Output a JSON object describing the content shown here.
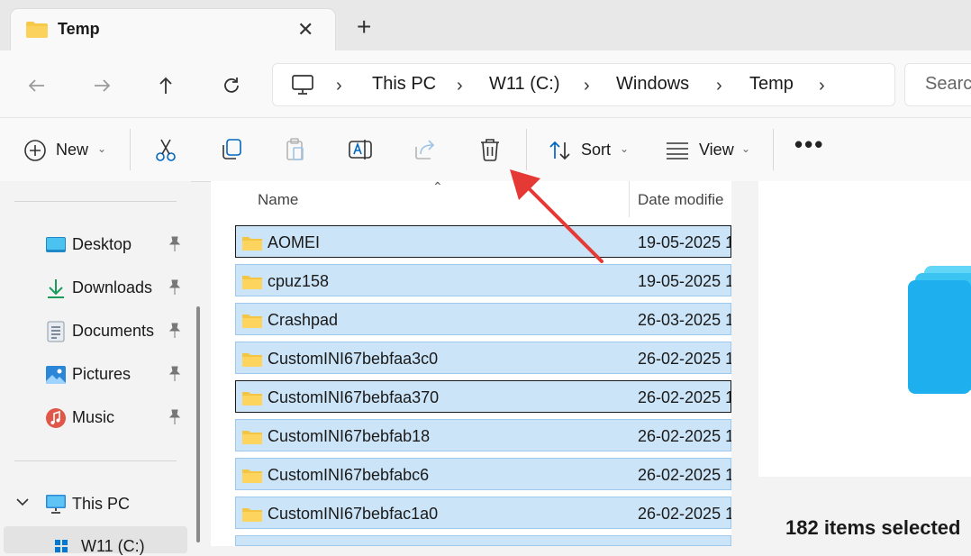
{
  "tab": {
    "title": "Temp",
    "icon": "folder-icon"
  },
  "breadcrumb": [
    "This PC",
    "W11 (C:)",
    "Windows",
    "Temp"
  ],
  "search": {
    "placeholder": "Search"
  },
  "toolbar": {
    "new_label": "New",
    "sort_label": "Sort",
    "view_label": "View"
  },
  "sidebar": {
    "quick_access": [
      {
        "label": "Desktop",
        "icon": "desktop-icon"
      },
      {
        "label": "Downloads",
        "icon": "downloads-icon"
      },
      {
        "label": "Documents",
        "icon": "documents-icon"
      },
      {
        "label": "Pictures",
        "icon": "pictures-icon"
      },
      {
        "label": "Music",
        "icon": "music-icon"
      }
    ],
    "this_pc": "This PC",
    "drive": "W11 (C:)"
  },
  "columns": {
    "name": "Name",
    "date": "Date modifie"
  },
  "files": [
    {
      "name": "AOMEI",
      "date": "19-05-2025 1"
    },
    {
      "name": "cpuz158",
      "date": "19-05-2025 1"
    },
    {
      "name": "Crashpad",
      "date": "26-03-2025 1"
    },
    {
      "name": "CustomINI67bebfaa3c0",
      "date": "26-02-2025 1"
    },
    {
      "name": "CustomINI67bebfaa370",
      "date": "26-02-2025 1"
    },
    {
      "name": "CustomINI67bebfab18",
      "date": "26-02-2025 1"
    },
    {
      "name": "CustomINI67bebfabc6",
      "date": "26-02-2025 1"
    },
    {
      "name": "CustomINI67bebfac1a0",
      "date": "26-02-2025 1"
    }
  ],
  "status": {
    "selection": "182 items selected"
  },
  "colors": {
    "selection_bg": "#cce4f7",
    "accent": "#0067c0",
    "arrow": "#e53935"
  }
}
